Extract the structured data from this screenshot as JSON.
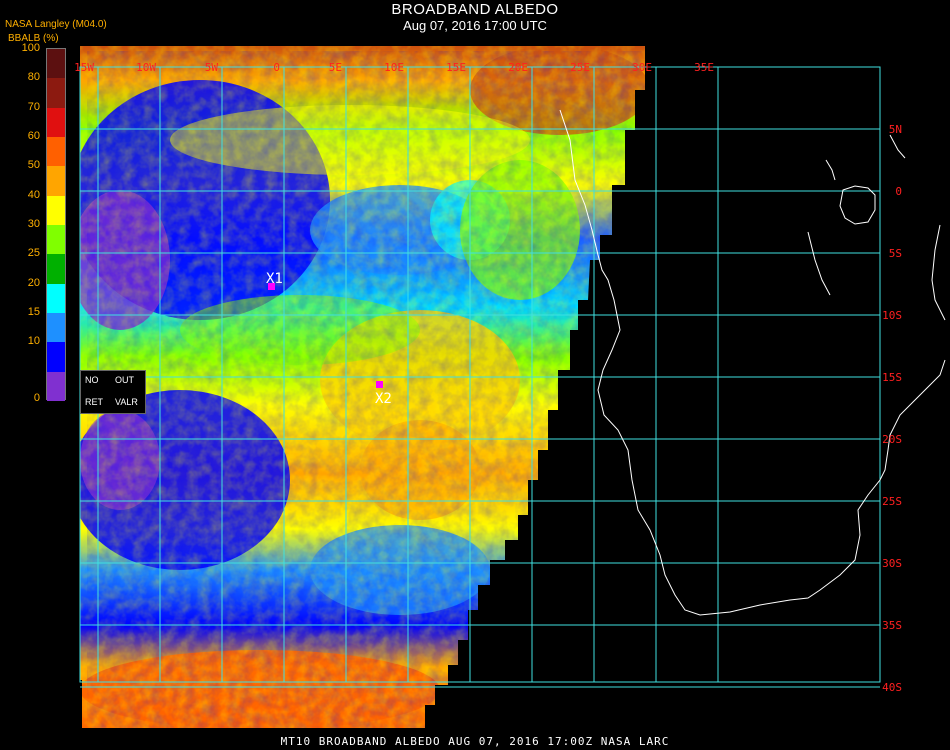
{
  "header": {
    "title": "BROADBAND ALBEDO",
    "subtitle": "Aug 07, 2016 17:00 UTC",
    "producer": "NASA Langley (M04.0)",
    "parameter": "BBALB (%)"
  },
  "colorbar": {
    "ticks": [
      "100",
      "80",
      "70",
      "60",
      "50",
      "40",
      "30",
      "25",
      "20",
      "15",
      "10",
      "0"
    ],
    "colors": [
      "#5c1010",
      "#8c1a10",
      "#e01010",
      "#ff6000",
      "#ffa500",
      "#ffff00",
      "#80ff00",
      "#00b000",
      "#00ffff",
      "#1e90ff",
      "#0000ff",
      "#8030d0"
    ]
  },
  "legend_box": {
    "no": "NO",
    "out": "OUT",
    "ret": "RET",
    "valr": "VALR"
  },
  "markers": [
    {
      "label": "X1",
      "color": "#ff00ff"
    },
    {
      "label": "X2",
      "color": "#ff00ff"
    }
  ],
  "map": {
    "top_lon_labels": [
      "15W",
      "10W",
      "5W",
      "0",
      "5E",
      "10E",
      "15E",
      "20E",
      "25E",
      "30E",
      "35E"
    ],
    "lat_labels": [
      "5N",
      "0",
      "5S",
      "10S",
      "15S",
      "20S",
      "25S",
      "30S",
      "35S",
      "40S"
    ],
    "grid_color": "#40e0e0",
    "label_color": "#ff2020",
    "coast_color": "#ffffff",
    "land_color": "#000000"
  },
  "footer": "MT10   BROADBAND ALBEDO    AUG 07, 2016 17:00Z    NASA LARC"
}
